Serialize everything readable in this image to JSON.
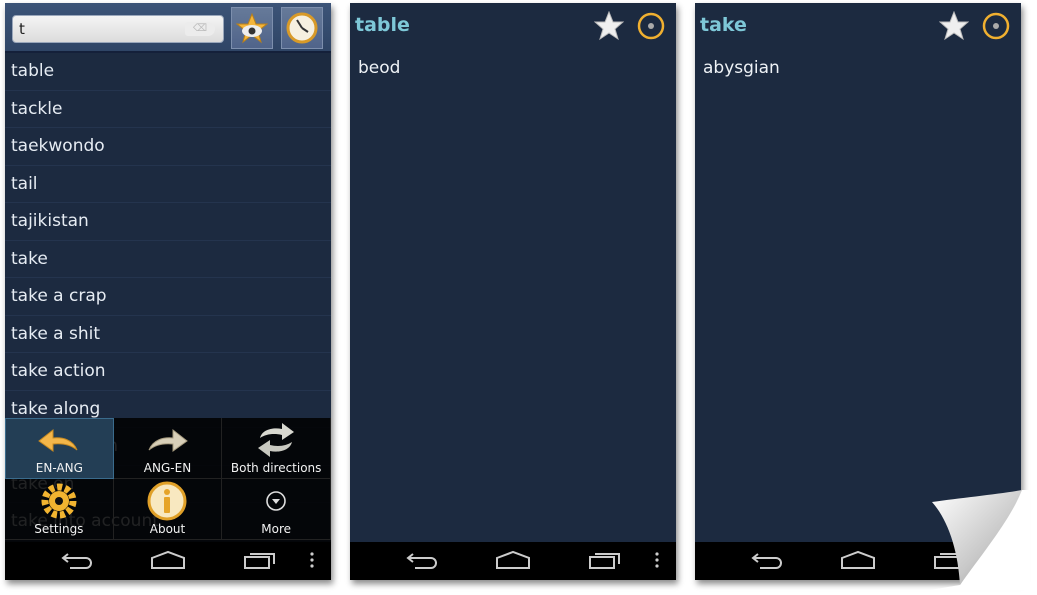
{
  "screen1": {
    "search": {
      "value": "t",
      "clear_label": "⌫"
    },
    "header_buttons": {
      "favorites": "favorites-star-eye-icon",
      "history": "history-clock-icon"
    },
    "word_list": [
      "table",
      "tackle",
      "taekwondo",
      "tail",
      "tajikistan",
      "take",
      "take a crap",
      "take a shit",
      "take action",
      "take along",
      "take an oath",
      "take on",
      "take into account"
    ],
    "menu": [
      {
        "label": "EN-ANG",
        "icon": "arrow-left-icon",
        "active": true
      },
      {
        "label": "ANG-EN",
        "icon": "arrow-right-icon",
        "active": false
      },
      {
        "label": "Both directions",
        "icon": "both-directions-icon",
        "active": false
      },
      {
        "label": "Settings",
        "icon": "gear-icon",
        "active": false
      },
      {
        "label": "About",
        "icon": "info-icon",
        "active": false
      },
      {
        "label": "More",
        "icon": "chevron-down-circle-icon",
        "active": false
      }
    ]
  },
  "screen2": {
    "title": "table",
    "translation": "beod"
  },
  "screen3": {
    "title": "take",
    "translation": "abysgian"
  },
  "colors": {
    "background": "#1c2a40",
    "title": "#7ec8d8",
    "accent": "#f0b030",
    "navbar": "#000000"
  }
}
